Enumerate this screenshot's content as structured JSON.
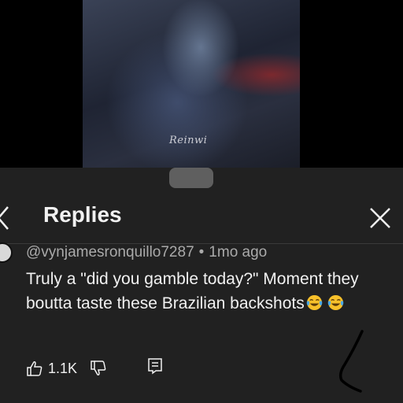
{
  "video": {
    "watermark": "Reinwi"
  },
  "replies_sheet": {
    "title": "Replies",
    "icons": {
      "back": "chevron-left-icon",
      "close": "close-icon"
    }
  },
  "comment": {
    "author": "@vynjamesronquillo7287",
    "separator": "•",
    "time": "1mo ago",
    "text": "Truly a \"did you gamble today?\" Moment they boutta taste these Brazilian backshots",
    "emojis": [
      "face-with-tears-of-joy",
      "face-with-tears-of-joy"
    ],
    "likes": "1.1K",
    "icons": {
      "like": "thumbs-up-icon",
      "dislike": "thumbs-down-icon",
      "reply": "reply-icon"
    }
  },
  "colors": {
    "sheet_bg": "#212121",
    "handle": "#5f5f5f",
    "meta_text": "#aaaaaa",
    "primary_text": "#f1f1f1"
  }
}
